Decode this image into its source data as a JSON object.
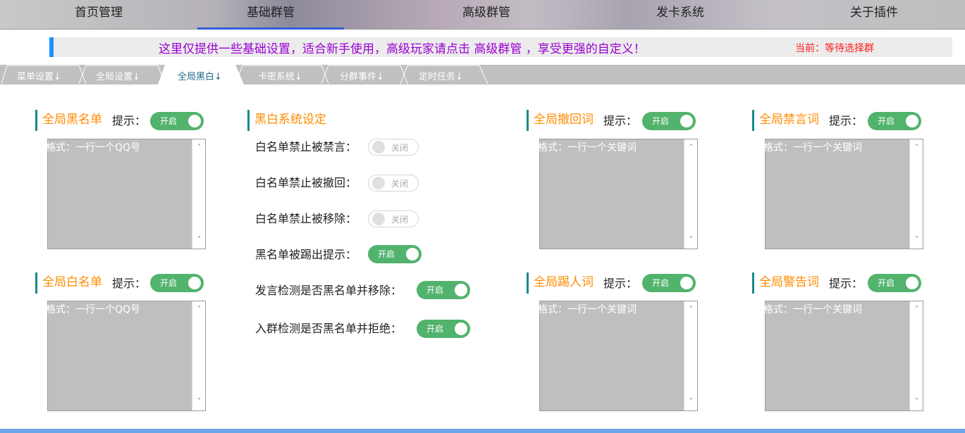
{
  "topnav": {
    "items": [
      {
        "label": "首页管理"
      },
      {
        "label": "基础群管"
      },
      {
        "label": "高级群管"
      },
      {
        "label": "发卡系统"
      },
      {
        "label": "关于插件"
      }
    ]
  },
  "notice": {
    "message": "这里仅提供一些基础设置，适合新手使用，高级玩家请点击 高级群管 ，享受更强的自定义！",
    "current": "当前：等待选择群"
  },
  "tabs": [
    {
      "label": "菜单设置↓"
    },
    {
      "label": "全局设置↓"
    },
    {
      "label": "全局黑白↓"
    },
    {
      "label": "卡密系统↓"
    },
    {
      "label": "分群事件↓"
    },
    {
      "label": "定时任务↓"
    }
  ],
  "common": {
    "hint": "提示：",
    "on": "开启",
    "off": "关闭",
    "ph_qq": "格式：一行一个QQ号",
    "ph_word": "格式：一行一个关键词",
    "scroll_up": "˄",
    "scroll_down": "˅"
  },
  "blacklist": {
    "title": "全局黑名单"
  },
  "whitelist": {
    "title": "全局白名单"
  },
  "bw_system": {
    "title": "黑白系统设定",
    "settings": [
      {
        "label": "白名单禁止被禁言：",
        "state": "off"
      },
      {
        "label": "白名单禁止被撤回：",
        "state": "off"
      },
      {
        "label": "白名单禁止被移除：",
        "state": "off"
      },
      {
        "label": "黑名单被踢出提示：",
        "state": "on"
      },
      {
        "label": "发言检测是否黑名单并移除：",
        "state": "on"
      },
      {
        "label": "入群检测是否黑名单并拒绝：",
        "state": "on"
      }
    ]
  },
  "recall_words": {
    "title": "全局撤回词"
  },
  "mute_words": {
    "title": "全局禁言词"
  },
  "kick_words": {
    "title": "全局踢人词"
  },
  "warn_words": {
    "title": "全局警告词"
  },
  "colors": {
    "accent": "#178b8b",
    "toggle_on": "#52b36c",
    "title": "#ff8c00",
    "notice": "#9b00d3",
    "current": "#ff1a1a"
  }
}
